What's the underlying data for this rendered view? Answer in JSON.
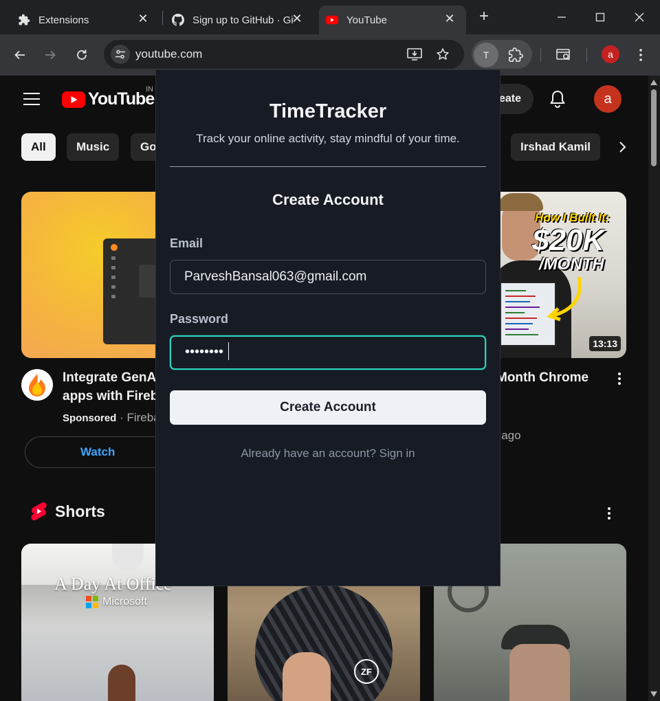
{
  "browser": {
    "tabs": [
      {
        "title": "Extensions",
        "icon": "puzzle-icon"
      },
      {
        "title": "Sign up to GitHub · GitHub",
        "icon": "github-icon"
      },
      {
        "title": "YouTube",
        "icon": "youtube-icon",
        "active": true
      }
    ],
    "url": "youtube.com",
    "extension_initial": "T",
    "profile_initial": "a"
  },
  "youtube": {
    "logo_text": "YouTube",
    "region": "IN",
    "create_label": "Create",
    "avatar_initial": "a",
    "chips": [
      "All",
      "Music",
      "Go",
      "Irshad Kamil"
    ],
    "videos": [
      {
        "title_line1": "Integrate GenAI",
        "title_line2": "apps with Firebase",
        "sponsored": "Sponsored",
        "separator": "·",
        "channel": "Firebase",
        "cta": "Watch"
      },
      {
        "title": "Month Chrome",
        "meta": "s ago",
        "duration": "13:13",
        "overlay_line1": "How I Built It:",
        "overlay_line2": "$20K",
        "overlay_line3": "/MONTH"
      }
    ],
    "shorts_label": "Shorts",
    "shorts": [
      {
        "overlay_title": "A Day At Office",
        "overlay_brand": "Microsoft"
      },
      {
        "overlay_title": "ZF"
      },
      {
        "overlay_title": ""
      }
    ]
  },
  "popup": {
    "title": "TimeTracker",
    "subtitle": "Track your online activity, stay mindful of your time.",
    "heading": "Create Account",
    "email_label": "Email",
    "email_value": "ParveshBansal063@gmail.com",
    "password_label": "Password",
    "password_mask": "••••••••",
    "submit_label": "Create Account",
    "signin_text": "Already have an account? Sign in"
  },
  "colors": {
    "accent_teal": "#2dd4bf",
    "popup_bg": "#161b24",
    "youtube_red": "#ff0000",
    "link_blue": "#3ea6ff"
  }
}
